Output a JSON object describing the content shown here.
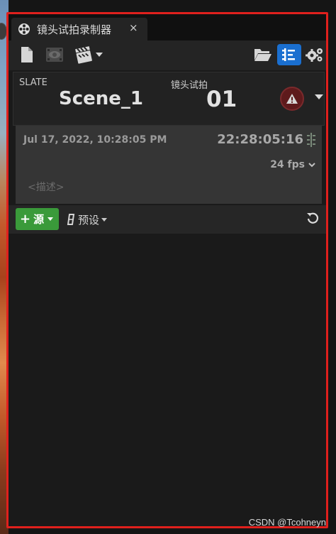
{
  "window": {
    "tab_title": "镜头试拍录制器",
    "close_label": "×",
    "tab_icon": "film-reel-icon"
  },
  "toolbar": {
    "left_icons": [
      "new-page-icon",
      "review-eye-icon",
      "clapperboard-icon"
    ],
    "right_icons": [
      "folder-open-icon",
      "takes-list-icon",
      "settings-gears-icon"
    ],
    "active_button": "takes-list-icon"
  },
  "slate": {
    "slate_label": "SLATE",
    "slate_value": "Scene_1",
    "take_label": "镜头试拍",
    "take_value": "01",
    "warning_icon": "warning-icon"
  },
  "info": {
    "date": "Jul 17, 2022, 10:28:05 PM",
    "timecode": "22:28:05:16",
    "frame_rate": "24 fps",
    "description_placeholder": "<描述>"
  },
  "sources": {
    "add_label": "源",
    "add_plus": "+",
    "preset_label": "预设",
    "reset_icon": "reset-icon"
  },
  "watermark": "CSDN @Tcohneyn",
  "colors": {
    "panel_bg": "#1a1a1a",
    "active_accent": "#1a6fd0",
    "add_button_green": "#3a9a3a",
    "warning_red": "#5e1a1c",
    "highlight_frame": "#e0201d"
  }
}
